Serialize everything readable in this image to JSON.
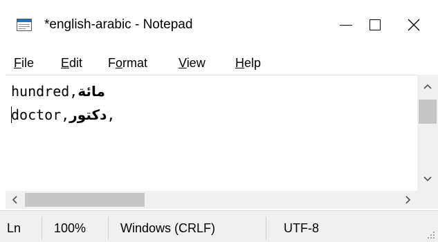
{
  "window": {
    "title": "*english-arabic - Notepad",
    "icon": "notepad-icon",
    "controls": {
      "minimize": "minimize-icon",
      "maximize": "maximize-icon",
      "close_glyph": "✕"
    }
  },
  "menu": {
    "items": [
      {
        "pre": "",
        "mnemonic": "F",
        "post": "ile"
      },
      {
        "pre": "",
        "mnemonic": "E",
        "post": "dit"
      },
      {
        "pre": "F",
        "mnemonic": "o",
        "post": "rmat"
      },
      {
        "pre": "",
        "mnemonic": "V",
        "post": "iew"
      },
      {
        "pre": "",
        "mnemonic": "H",
        "post": "elp"
      }
    ]
  },
  "editor": {
    "lines": [
      {
        "latin": "hundred,",
        "arabic": "مائة",
        "tail": ""
      },
      {
        "latin": "doctor,",
        "arabic": "دكتور",
        "tail": ","
      }
    ]
  },
  "scrollbars": {
    "up": "▲",
    "down": "▼",
    "left": "<",
    "right": ">"
  },
  "statusbar": {
    "line_col": "Ln",
    "zoom": "100%",
    "line_ending": "Windows (CRLF)",
    "encoding": "UTF-8"
  },
  "colors": {
    "chrome": "#f0f0f0",
    "thumb": "#c6c6c6",
    "icon_blue": "#1e73be"
  }
}
